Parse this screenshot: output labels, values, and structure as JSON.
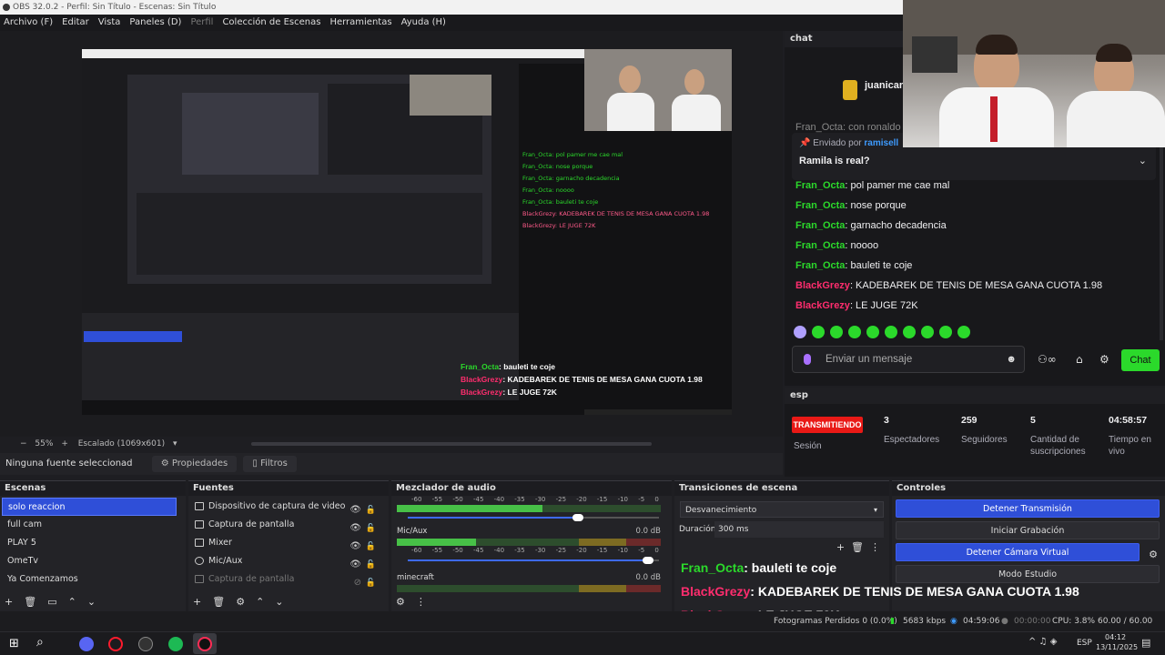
{
  "window": {
    "title": "OBS 32.0.2 - Perfil: Sin Título - Escenas: Sin Título"
  },
  "menu": [
    "Archivo (F)",
    "Editar",
    "Vista",
    "Paneles (D)",
    "Perfil",
    "Colección de Escenas",
    "Herramientas",
    "Ayuda (H)"
  ],
  "preview": {
    "zoom": "55%",
    "scaled": "Escalado (1069x601)",
    "overlay_lines": [
      {
        "user": "Fran_Octa",
        "text": ": bauleti te coje"
      },
      {
        "user": "BlackGrezy",
        "text": ": KADEBAREK DE TENIS DE MESA GANA CUOTA 1.98"
      },
      {
        "user": "BlackGrezy",
        "text": ": LE JUGE 72K"
      }
    ],
    "mini_chat": [
      "Fran_Octa: pol pamer me cae mal",
      "Fran_Octa: nose porque",
      "Fran_Octa: garnacho decadencia",
      "Fran_Octa: noooo",
      "Fran_Octa: bauleti te coje",
      "BlackGrezy: KADEBAREK DE TENIS DE MESA GANA CUOTA 1.98",
      "BlackGrezy: LE JUGE 72K"
    ]
  },
  "source_bar": {
    "selected": "Ninguna fuente seleccionad",
    "props": "Propiedades",
    "filters": "Filtros"
  },
  "scenes": {
    "title": "Escenas",
    "items": [
      "solo reaccion",
      "full cam",
      "PLAY 5",
      "OmeTv",
      "Ya Comenzamos"
    ]
  },
  "sources": {
    "title": "Fuentes",
    "items": [
      "Dispositivo de captura de video",
      "Captura de pantalla",
      "Mixer",
      "Mic/Aux",
      "Captura de pantalla"
    ]
  },
  "mixer": {
    "title": "Mezclador de audio",
    "scale": [
      "-60",
      "-55",
      "-50",
      "-45",
      "-40",
      "-35",
      "-30",
      "-25",
      "-20",
      "-15",
      "-10",
      "-5",
      "0"
    ],
    "channels": [
      {
        "name": "",
        "db": "",
        "level": 0.55,
        "volume": 0.7
      },
      {
        "name": "Mic/Aux",
        "db": "0.0 dB",
        "level": 0.3,
        "volume": 0.98
      },
      {
        "name": "minecraft",
        "db": "0.0 dB",
        "level": 0.0,
        "volume": 0.9
      }
    ]
  },
  "transitions": {
    "title": "Transiciones de escena",
    "type": "Desvanecimiento",
    "duration_label": "Duración",
    "duration": "300 ms"
  },
  "controls": {
    "title": "Controles",
    "buttons": [
      "Detener Transmisión",
      "Iniciar Grabación",
      "Detener Cámara Virtual",
      "Modo Estudio"
    ]
  },
  "chat": {
    "title": "chat",
    "user": "juanicar",
    "pinned_by": "Enviado por",
    "pinned_user": "ramisell",
    "pinned_msg": "Ramila is real?",
    "top_partial": "Fran_Octa: con ronaldo c",
    "messages": [
      {
        "user": "Fran_Octa",
        "text": ": pol pamer me cae mal",
        "color": "#2bd92b"
      },
      {
        "user": "Fran_Octa",
        "text": ": nose porque",
        "color": "#2bd92b"
      },
      {
        "user": "Fran_Octa",
        "text": ": garnacho decadencia",
        "color": "#2bd92b"
      },
      {
        "user": "Fran_Octa",
        "text": ": noooo",
        "color": "#2bd92b"
      },
      {
        "user": "Fran_Octa",
        "text": ": bauleti te coje",
        "color": "#2bd92b"
      },
      {
        "user": "BlackGrezy",
        "text": ": KADEBAREK DE TENIS DE MESA GANA CUOTA 1.98",
        "color": "#ff2d6e"
      },
      {
        "user": "BlackGrezy",
        "text": ": LE JUGE 72K",
        "color": "#ff2d6e"
      }
    ],
    "input_placeholder": "Enviar un mensaje",
    "send": "Chat"
  },
  "esp": {
    "title": "esp",
    "live": "TRANSMITIENDO",
    "session": "Sesión",
    "stats": [
      {
        "value": "3",
        "label": "Espectadores"
      },
      {
        "value": "259",
        "label": "Seguidores"
      },
      {
        "value": "5",
        "label": "Cantidad de suscripciones"
      },
      {
        "value": "04:58:57",
        "label": "Tiempo en vivo"
      }
    ]
  },
  "status": {
    "dropped": "Fotogramas Perdidos 0 (0.0%)",
    "bitrate": "5683 kbps",
    "live_time": "04:59:06",
    "rec_time": "00:00:00",
    "cpu": "CPU: 3.8%",
    "fps": "60.00 / 60.00 FPS"
  },
  "taskbar": {
    "lang": "ESP",
    "time": "04:12",
    "date": "13/11/2025"
  },
  "colors": {
    "accent": "#2f4fd8",
    "twitch_green": "#2bd92b",
    "live_red": "#e91916",
    "user_pink": "#ff2d6e"
  }
}
